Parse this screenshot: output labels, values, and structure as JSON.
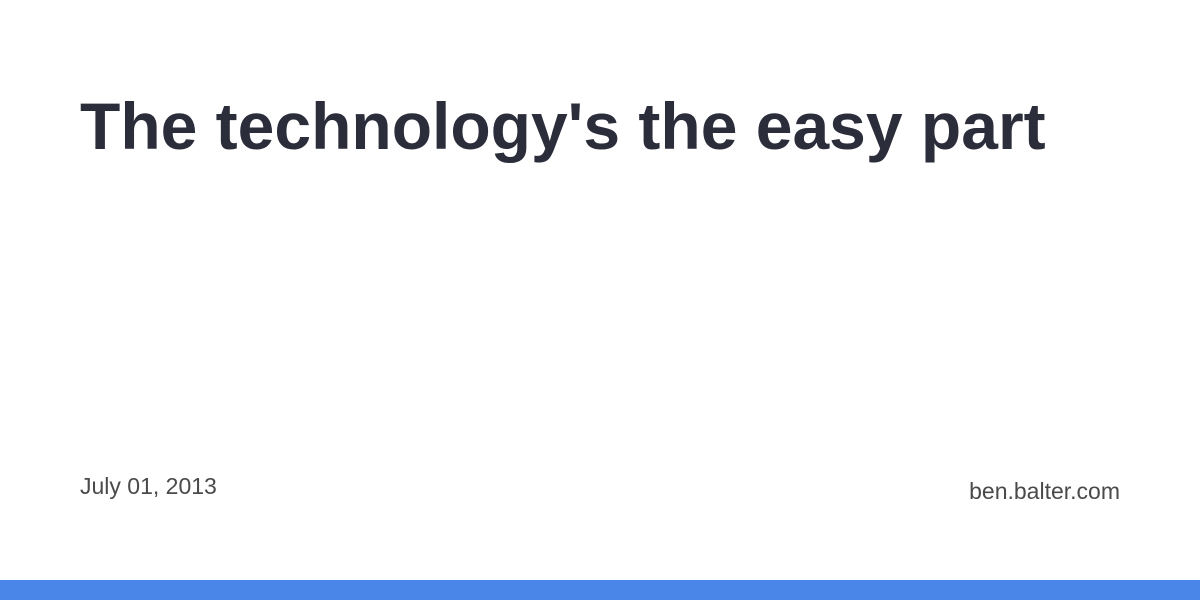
{
  "card": {
    "title": "The technology's the easy part",
    "date": "July 01, 2013",
    "site": "ben.balter.com"
  },
  "colors": {
    "title": "#2b2d3b",
    "meta_text": "#4a4a4a",
    "accent": "#4a86e8",
    "background": "#ffffff"
  }
}
